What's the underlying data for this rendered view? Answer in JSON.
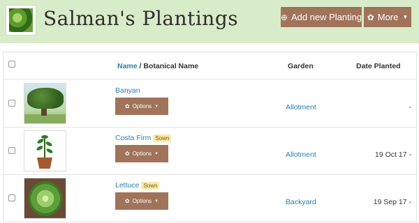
{
  "header": {
    "title": "Salman's Plantings",
    "add_button": "Add new Planting",
    "more_button": "More"
  },
  "table": {
    "headers": {
      "name": "Name",
      "separator": " / ",
      "botanical": "Botanical Name",
      "garden": "Garden",
      "date": "Date Planted"
    },
    "rows": [
      {
        "name": "Banyan",
        "badge": "",
        "options": "Options",
        "garden": "Allotment",
        "date": "-"
      },
      {
        "name": "Costa Firm",
        "badge": "Sown",
        "options": "Options",
        "garden": "Allotment",
        "date": "19 Oct 17 -"
      },
      {
        "name": "Lettuce",
        "badge": "Sown",
        "options": "Options",
        "garden": "Backyard",
        "date": "19 Sep 17 -"
      }
    ]
  },
  "colors": {
    "header_bg": "#d9ecc9",
    "button_brown": "#a0735a",
    "link_blue": "#2a7fb0",
    "badge_yellow": "#fbe9a7"
  },
  "icons": {
    "add": "plus-circle-icon",
    "more": "gear-icon",
    "options": "gear-icon",
    "caret": "caret-down-icon"
  }
}
